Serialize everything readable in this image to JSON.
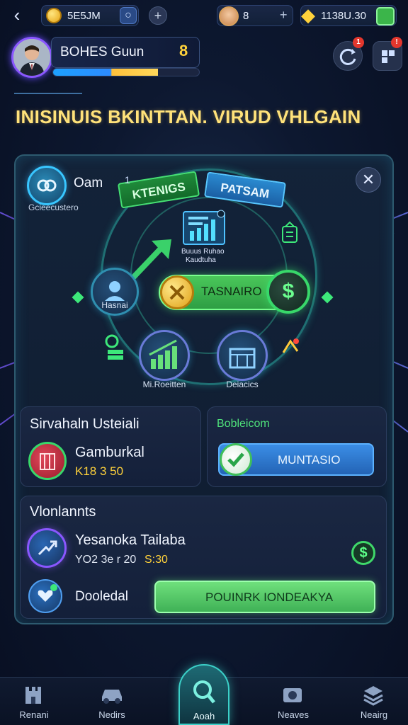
{
  "topbar": {
    "currency_1": "5E5JM",
    "energy": "8",
    "gems": "1138U.30"
  },
  "profile": {
    "name": "BOHES Guun",
    "level": "8",
    "xp_fraction": 0.72
  },
  "headline": "INISINUIS BKINTTAN. VIRUD VHLGAIN",
  "panel": {
    "user_label": "Oam",
    "user_sub": "Gcieecustero",
    "banner_left": "KTENIGS",
    "banner_right": "PATSAM",
    "chart_caption_line1": "Buuus Ruhao",
    "chart_caption_line2": "Kaudtuha",
    "left_node_label": "Hasnai",
    "center_button": "TASNAIRO",
    "bottom_left_node_label": "Mi.Roeitten",
    "bottom_right_node_label": "Deiacics"
  },
  "card_left": {
    "title": "Sirvahaln Usteiali",
    "item_title": "Gamburkal",
    "item_value": "K18 3 50"
  },
  "card_right": {
    "title": "Bobleicom",
    "button": "MUNTASIO"
  },
  "section": {
    "title": "Vlonlannts",
    "row1_title": "Yesanoka Tailaba",
    "row1_sub": "YO2 3e r 20",
    "row1_value": "S:30",
    "row2_title": "Dooledal",
    "row2_button": "POUINRK IONDEAKYA"
  },
  "nav": {
    "items": [
      "Renani",
      "Nedirs",
      "Aoah",
      "Neaves",
      "Neairg"
    ],
    "active_index": 2
  },
  "colors": {
    "accent_gold": "#ffe27a",
    "accent_green": "#4ac75a",
    "accent_blue": "#3b8ee6",
    "accent_teal": "#3bd0c8"
  }
}
